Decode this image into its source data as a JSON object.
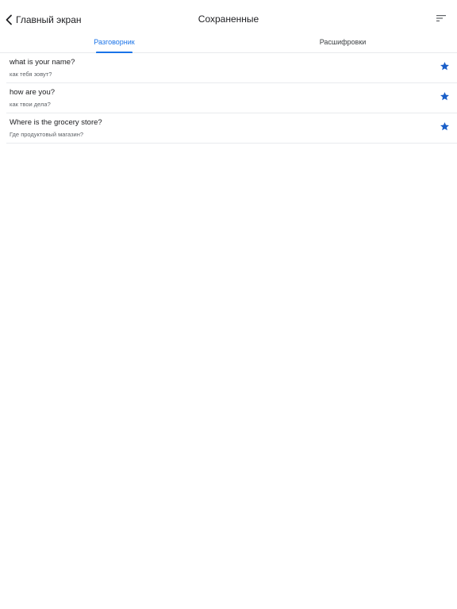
{
  "header": {
    "back_label": "Главный экран",
    "title": "Сохраненные",
    "back_icon": "chevron-left-icon",
    "sort_icon": "sort-icon"
  },
  "tabs": [
    {
      "label": "Разговорник",
      "active": true
    },
    {
      "label": "Расшифровки",
      "active": false
    }
  ],
  "items": [
    {
      "text": "what is your name?",
      "translation": "как тебя зовут?",
      "starred": true
    },
    {
      "text": "how are you?",
      "translation": "как твои дела?",
      "starred": true
    },
    {
      "text": "Where is the grocery store?",
      "translation": "Где продуктовый магазин?",
      "starred": true
    }
  ],
  "colors": {
    "accent": "#1a73e8",
    "star": "#1a5fc9",
    "divider": "#e8eaed"
  }
}
